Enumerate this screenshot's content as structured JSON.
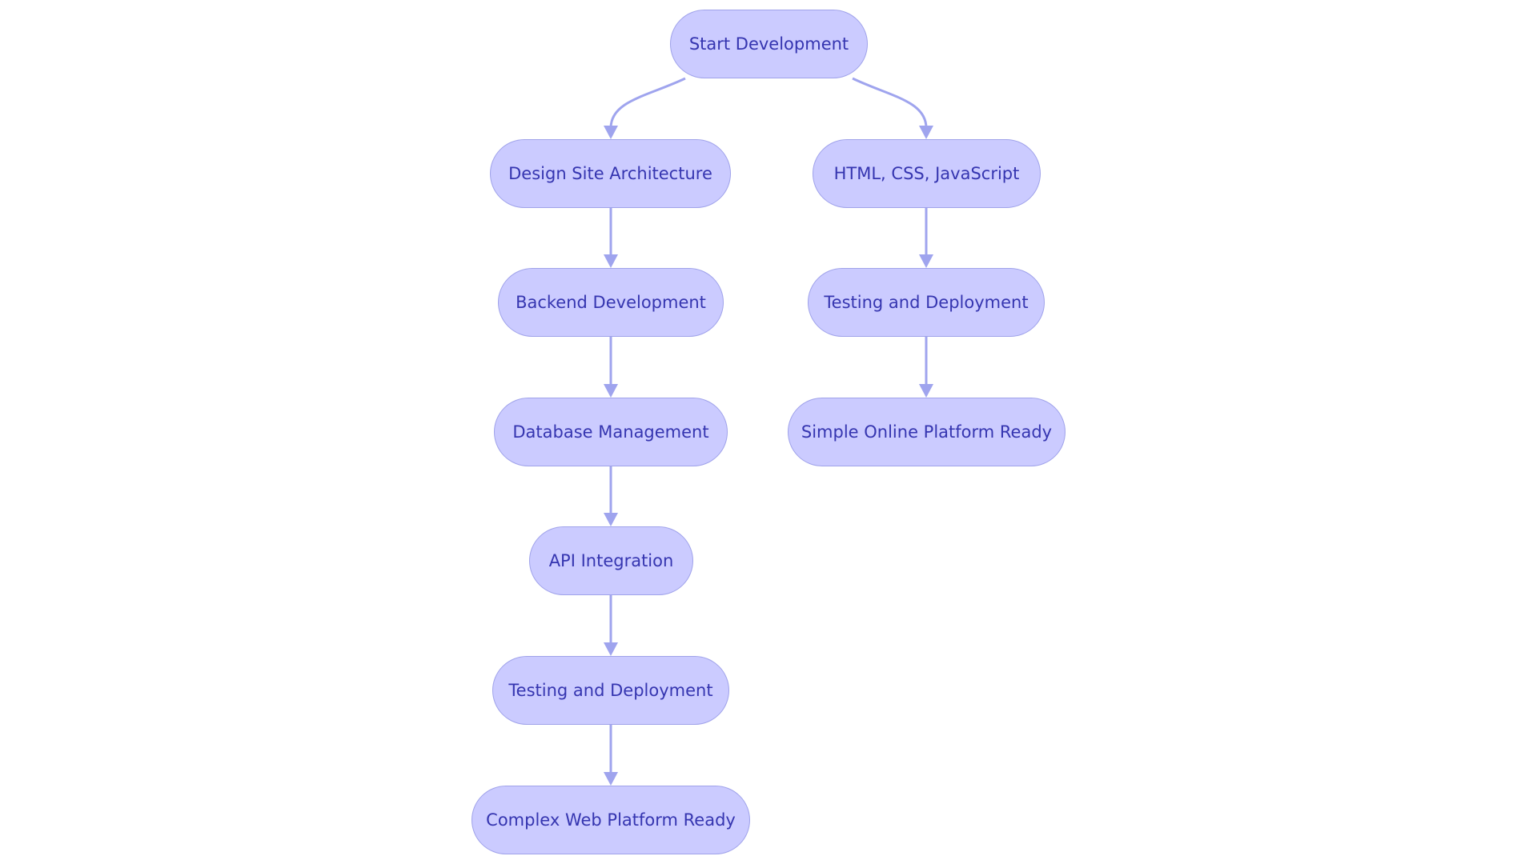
{
  "diagram": {
    "type": "flowchart",
    "direction": "top-down",
    "colors": {
      "node_fill": "#cbcbff",
      "node_stroke": "#9fa2ea",
      "text": "#3535b0",
      "edge": "#9fa4ee"
    },
    "nodes": [
      {
        "id": "start",
        "label": "Start Development"
      },
      {
        "id": "design",
        "label": "Design Site Architecture"
      },
      {
        "id": "html",
        "label": "HTML, CSS, JavaScript"
      },
      {
        "id": "backend",
        "label": "Backend Development"
      },
      {
        "id": "testR",
        "label": "Testing and Deployment"
      },
      {
        "id": "db",
        "label": "Database Management"
      },
      {
        "id": "simple",
        "label": "Simple Online Platform Ready"
      },
      {
        "id": "api",
        "label": "API Integration"
      },
      {
        "id": "testL",
        "label": "Testing and Deployment"
      },
      {
        "id": "complex",
        "label": "Complex Web Platform Ready"
      }
    ],
    "edges": [
      {
        "from": "start",
        "to": "design"
      },
      {
        "from": "start",
        "to": "html"
      },
      {
        "from": "design",
        "to": "backend"
      },
      {
        "from": "backend",
        "to": "db"
      },
      {
        "from": "db",
        "to": "api"
      },
      {
        "from": "api",
        "to": "testL"
      },
      {
        "from": "testL",
        "to": "complex"
      },
      {
        "from": "html",
        "to": "testR"
      },
      {
        "from": "testR",
        "to": "simple"
      }
    ]
  }
}
